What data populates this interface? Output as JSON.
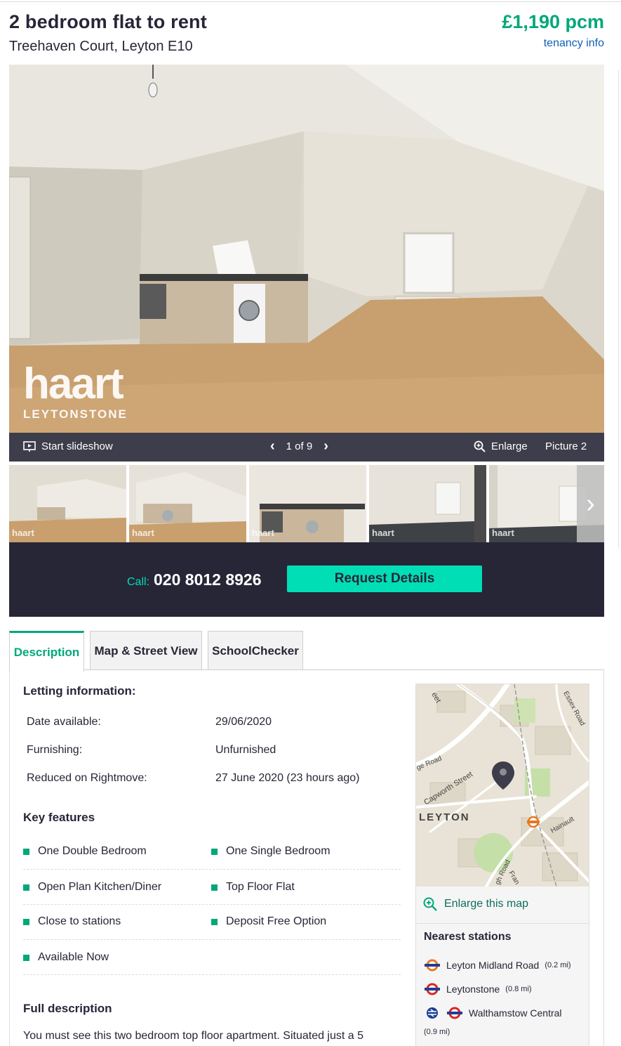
{
  "listing": {
    "title": "2 bedroom flat to rent",
    "address": "Treehaven Court, Leyton E10",
    "price": "£1,190 pcm",
    "tenancy_link": "tenancy info"
  },
  "gallery": {
    "watermark_brand": "haart",
    "watermark_branch": "LEYTONSTONE",
    "thumb_watermark": "haart",
    "start_slideshow": "Start slideshow",
    "counter": "1 of 9",
    "enlarge": "Enlarge",
    "picture_label": "Picture 2"
  },
  "contact": {
    "call_label": "Call:",
    "phone": "020 8012 8926",
    "request_button": "Request Details"
  },
  "tabs": [
    {
      "label": "Description",
      "active": true
    },
    {
      "label": "Map & Street View",
      "active": false
    },
    {
      "label": "SchoolChecker",
      "active": false
    }
  ],
  "letting": {
    "heading": "Letting information:",
    "rows": [
      {
        "label": "Date available:",
        "value": "29/06/2020"
      },
      {
        "label": "Furnishing:",
        "value": "Unfurnished"
      },
      {
        "label": "Reduced on Rightmove:",
        "value": "27 June 2020 (23 hours ago)"
      }
    ]
  },
  "key_features": {
    "heading": "Key features",
    "items": [
      "One Double Bedroom",
      "One Single Bedroom",
      "Open Plan Kitchen/Diner",
      "Top Floor Flat",
      "Close to stations",
      "Deposit Free Option",
      "Available Now"
    ]
  },
  "full_description": {
    "heading": "Full description",
    "text": "You must see this two bedroom top floor apartment. Situated just a 5"
  },
  "map": {
    "labels": {
      "street_top": "eet",
      "essex_road": "Essex Road",
      "ge_road": "ge Road",
      "capworth": "Capworth Street",
      "leyton": "LEYTON",
      "hainault": "Hainault",
      "gh_road": "gh Road",
      "fran": "Fran"
    },
    "enlarge_link": "Enlarge this map"
  },
  "nearest_stations": {
    "heading": "Nearest stations",
    "stations": [
      {
        "name": "Leyton Midland Road",
        "distance": "(0.2 mi)"
      },
      {
        "name": "Leytonstone",
        "distance": "(0.8 mi)"
      },
      {
        "name": "Walthamstow Central",
        "distance": "(0.9 mi)"
      }
    ]
  },
  "colors": {
    "brand_green": "#00a87a",
    "button_mint": "#00deb6",
    "dark_navy": "#262637",
    "link_blue": "#0e61b6"
  }
}
